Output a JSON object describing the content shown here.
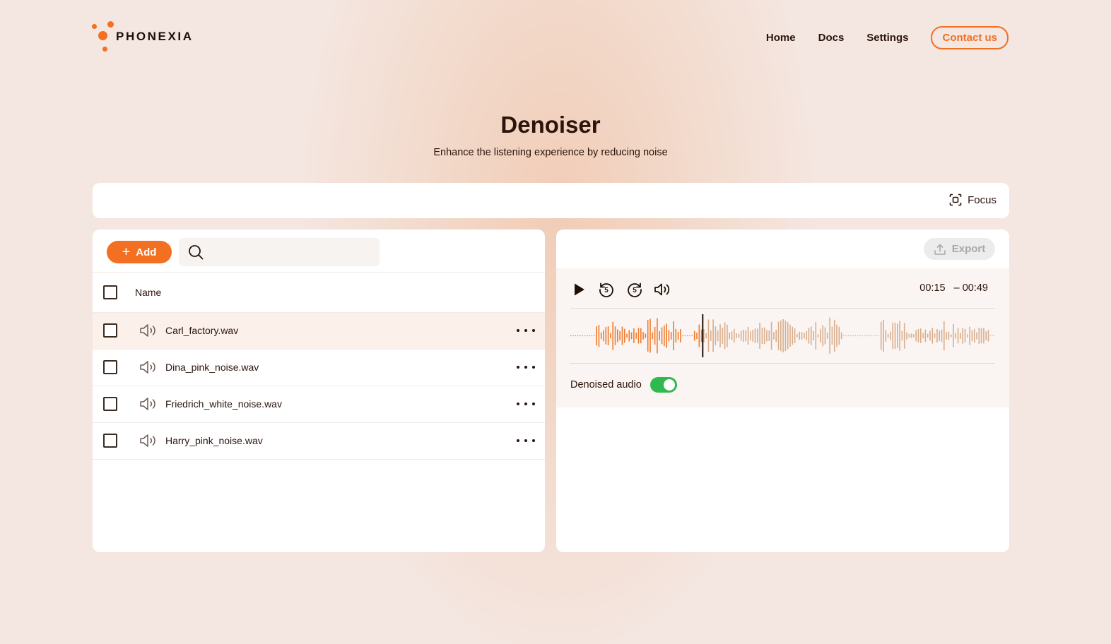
{
  "brand": {
    "name": "PHONEXIA",
    "accent": "#f36f21"
  },
  "nav": {
    "home": "Home",
    "docs": "Docs",
    "settings": "Settings",
    "contact": "Contact us"
  },
  "page": {
    "title": "Denoiser",
    "subtitle": "Enhance the listening experience by reducing noise"
  },
  "focus_label": "Focus",
  "files": {
    "add_label": "Add",
    "search_placeholder": "",
    "column_name": "Name",
    "rows": [
      {
        "name": "Carl_factory.wav",
        "selected": true
      },
      {
        "name": "Dina_pink_noise.wav",
        "selected": false
      },
      {
        "name": "Friedrich_white_noise.wav",
        "selected": false
      },
      {
        "name": "Harry_pink_noise.wav",
        "selected": false
      }
    ]
  },
  "player": {
    "export_label": "Export",
    "current_time": "00:15",
    "remaining_time": "– 00:49",
    "progress_fraction": 0.31,
    "denoised_label": "Denoised audio",
    "denoised_on": true,
    "colors": {
      "played": "#f07a2c",
      "unplayed": "#d9ad8c",
      "toggle_on": "#2fb94f"
    }
  }
}
